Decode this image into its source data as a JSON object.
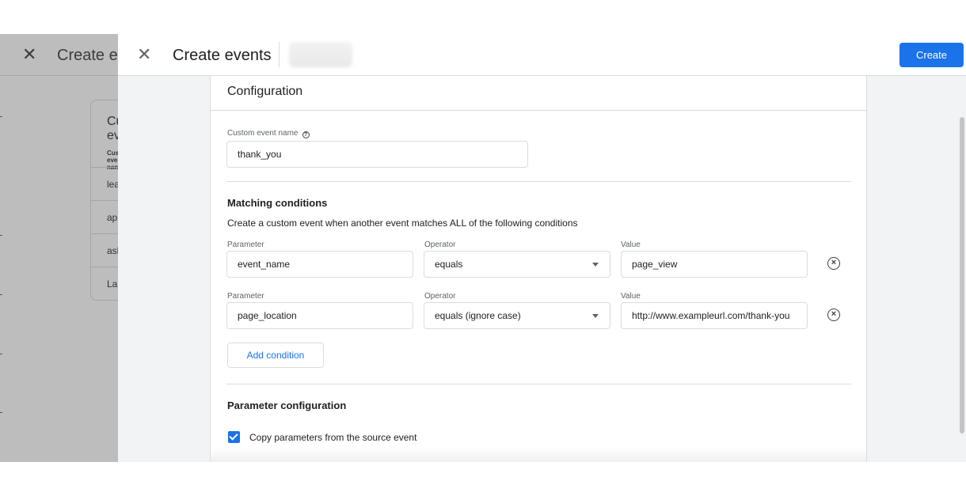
{
  "background_dialog": {
    "title": "Create events",
    "card_title": "Custom events",
    "card_column": "Custom event name",
    "rows": [
      "lead",
      "apply",
      "ask",
      "Landing"
    ]
  },
  "dialog": {
    "title": "Create events",
    "create_label": "Create",
    "accent_color": "#1a73e8"
  },
  "configuration": {
    "title": "Configuration",
    "event_name_label": "Custom event name",
    "event_name_value": "thank_you",
    "matching": {
      "title": "Matching conditions",
      "description": "Create a custom event when another event matches ALL of the following conditions",
      "parameter_label": "Parameter",
      "operator_label": "Operator",
      "value_label": "Value",
      "conditions": [
        {
          "parameter": "event_name",
          "operator": "equals",
          "value": "page_view"
        },
        {
          "parameter": "page_location",
          "operator": "equals (ignore case)",
          "value": "http://www.exampleurl.com/thank-you"
        }
      ],
      "add_label": "Add condition"
    },
    "parameter_config": {
      "title": "Parameter configuration",
      "copy_label": "Copy parameters from the source event",
      "copy_checked": true
    }
  }
}
